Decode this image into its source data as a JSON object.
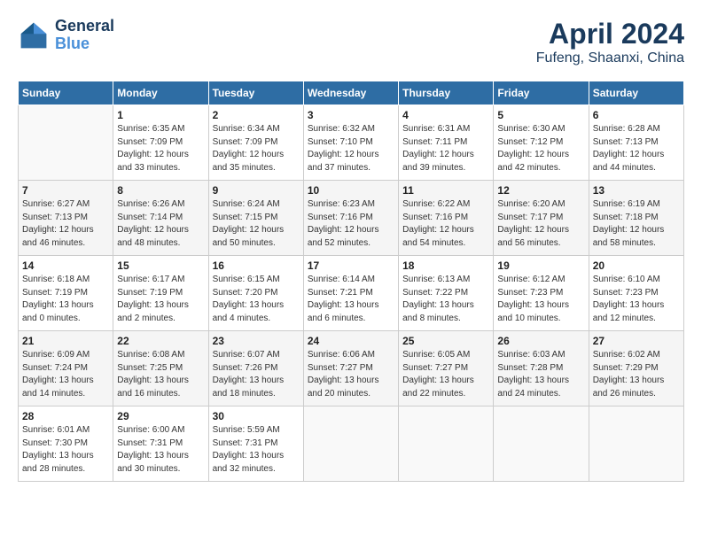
{
  "header": {
    "logo_line1": "General",
    "logo_line2": "Blue",
    "month_title": "April 2024",
    "location": "Fufeng, Shaanxi, China"
  },
  "days_of_week": [
    "Sunday",
    "Monday",
    "Tuesday",
    "Wednesday",
    "Thursday",
    "Friday",
    "Saturday"
  ],
  "weeks": [
    [
      {
        "num": "",
        "info": ""
      },
      {
        "num": "1",
        "info": "Sunrise: 6:35 AM\nSunset: 7:09 PM\nDaylight: 12 hours\nand 33 minutes."
      },
      {
        "num": "2",
        "info": "Sunrise: 6:34 AM\nSunset: 7:09 PM\nDaylight: 12 hours\nand 35 minutes."
      },
      {
        "num": "3",
        "info": "Sunrise: 6:32 AM\nSunset: 7:10 PM\nDaylight: 12 hours\nand 37 minutes."
      },
      {
        "num": "4",
        "info": "Sunrise: 6:31 AM\nSunset: 7:11 PM\nDaylight: 12 hours\nand 39 minutes."
      },
      {
        "num": "5",
        "info": "Sunrise: 6:30 AM\nSunset: 7:12 PM\nDaylight: 12 hours\nand 42 minutes."
      },
      {
        "num": "6",
        "info": "Sunrise: 6:28 AM\nSunset: 7:13 PM\nDaylight: 12 hours\nand 44 minutes."
      }
    ],
    [
      {
        "num": "7",
        "info": "Sunrise: 6:27 AM\nSunset: 7:13 PM\nDaylight: 12 hours\nand 46 minutes."
      },
      {
        "num": "8",
        "info": "Sunrise: 6:26 AM\nSunset: 7:14 PM\nDaylight: 12 hours\nand 48 minutes."
      },
      {
        "num": "9",
        "info": "Sunrise: 6:24 AM\nSunset: 7:15 PM\nDaylight: 12 hours\nand 50 minutes."
      },
      {
        "num": "10",
        "info": "Sunrise: 6:23 AM\nSunset: 7:16 PM\nDaylight: 12 hours\nand 52 minutes."
      },
      {
        "num": "11",
        "info": "Sunrise: 6:22 AM\nSunset: 7:16 PM\nDaylight: 12 hours\nand 54 minutes."
      },
      {
        "num": "12",
        "info": "Sunrise: 6:20 AM\nSunset: 7:17 PM\nDaylight: 12 hours\nand 56 minutes."
      },
      {
        "num": "13",
        "info": "Sunrise: 6:19 AM\nSunset: 7:18 PM\nDaylight: 12 hours\nand 58 minutes."
      }
    ],
    [
      {
        "num": "14",
        "info": "Sunrise: 6:18 AM\nSunset: 7:19 PM\nDaylight: 13 hours\nand 0 minutes."
      },
      {
        "num": "15",
        "info": "Sunrise: 6:17 AM\nSunset: 7:19 PM\nDaylight: 13 hours\nand 2 minutes."
      },
      {
        "num": "16",
        "info": "Sunrise: 6:15 AM\nSunset: 7:20 PM\nDaylight: 13 hours\nand 4 minutes."
      },
      {
        "num": "17",
        "info": "Sunrise: 6:14 AM\nSunset: 7:21 PM\nDaylight: 13 hours\nand 6 minutes."
      },
      {
        "num": "18",
        "info": "Sunrise: 6:13 AM\nSunset: 7:22 PM\nDaylight: 13 hours\nand 8 minutes."
      },
      {
        "num": "19",
        "info": "Sunrise: 6:12 AM\nSunset: 7:23 PM\nDaylight: 13 hours\nand 10 minutes."
      },
      {
        "num": "20",
        "info": "Sunrise: 6:10 AM\nSunset: 7:23 PM\nDaylight: 13 hours\nand 12 minutes."
      }
    ],
    [
      {
        "num": "21",
        "info": "Sunrise: 6:09 AM\nSunset: 7:24 PM\nDaylight: 13 hours\nand 14 minutes."
      },
      {
        "num": "22",
        "info": "Sunrise: 6:08 AM\nSunset: 7:25 PM\nDaylight: 13 hours\nand 16 minutes."
      },
      {
        "num": "23",
        "info": "Sunrise: 6:07 AM\nSunset: 7:26 PM\nDaylight: 13 hours\nand 18 minutes."
      },
      {
        "num": "24",
        "info": "Sunrise: 6:06 AM\nSunset: 7:27 PM\nDaylight: 13 hours\nand 20 minutes."
      },
      {
        "num": "25",
        "info": "Sunrise: 6:05 AM\nSunset: 7:27 PM\nDaylight: 13 hours\nand 22 minutes."
      },
      {
        "num": "26",
        "info": "Sunrise: 6:03 AM\nSunset: 7:28 PM\nDaylight: 13 hours\nand 24 minutes."
      },
      {
        "num": "27",
        "info": "Sunrise: 6:02 AM\nSunset: 7:29 PM\nDaylight: 13 hours\nand 26 minutes."
      }
    ],
    [
      {
        "num": "28",
        "info": "Sunrise: 6:01 AM\nSunset: 7:30 PM\nDaylight: 13 hours\nand 28 minutes."
      },
      {
        "num": "29",
        "info": "Sunrise: 6:00 AM\nSunset: 7:31 PM\nDaylight: 13 hours\nand 30 minutes."
      },
      {
        "num": "30",
        "info": "Sunrise: 5:59 AM\nSunset: 7:31 PM\nDaylight: 13 hours\nand 32 minutes."
      },
      {
        "num": "",
        "info": ""
      },
      {
        "num": "",
        "info": ""
      },
      {
        "num": "",
        "info": ""
      },
      {
        "num": "",
        "info": ""
      }
    ]
  ]
}
